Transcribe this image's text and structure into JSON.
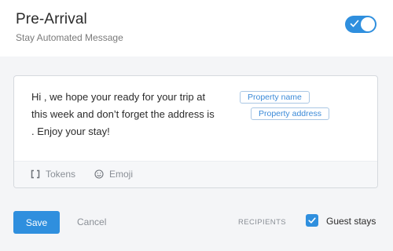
{
  "header": {
    "title": "Pre-Arrival",
    "subtitle": "Stay Automated Message",
    "toggle_on": true
  },
  "editor": {
    "message_lines": [
      "Hi , we hope your ready for your trip at",
      "this week and don’t forget the address is",
      ". Enjoy your stay!"
    ],
    "tokens": [
      "Property name",
      "Property address"
    ],
    "footer": {
      "tokens_label": "Tokens",
      "emoji_label": "Emoji"
    }
  },
  "actions": {
    "save_label": "Save",
    "cancel_label": "Cancel"
  },
  "recipients": {
    "label": "RECIPIENTS",
    "option_label": "Guest stays",
    "option_checked": true
  },
  "colors": {
    "accent": "#2f8fde",
    "background": "#f4f5f7",
    "text": "#2b2b2b",
    "muted": "#8a8f96"
  },
  "icons": [
    "check-icon",
    "brackets-icon",
    "emoji-icon"
  ]
}
